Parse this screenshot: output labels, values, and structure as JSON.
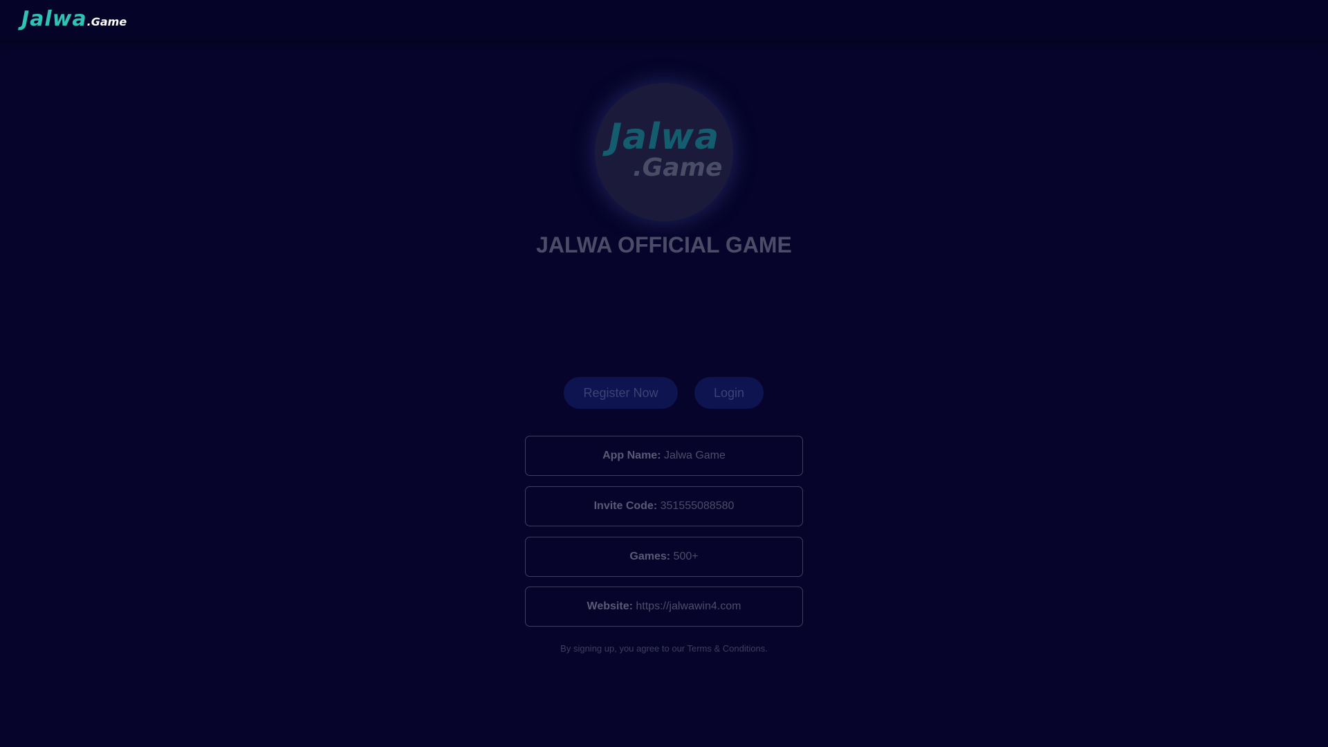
{
  "header": {
    "brand_main": "Jalwa",
    "brand_sub": ".Game"
  },
  "hero": {
    "logo_main": "Jalwa",
    "logo_sub": ".Game",
    "title": "JALWA OFFICIAL GAME"
  },
  "actions": {
    "register_label": "Register Now",
    "login_label": "Login"
  },
  "info": {
    "app_name_label": "App Name:",
    "app_name_value": "Jalwa Game",
    "invite_label": "Invite Code:",
    "invite_value": "351555088580",
    "games_label": "Games:",
    "games_value": "500+",
    "website_label": "Website:",
    "website_value": "https://jalwawin4.com"
  },
  "footer": {
    "terms": "By signing up, you agree to our Terms & Conditions."
  },
  "colors": {
    "background": "#06042a",
    "brand_teal": "#2fc3b8",
    "button_bg": "#0d1450"
  }
}
